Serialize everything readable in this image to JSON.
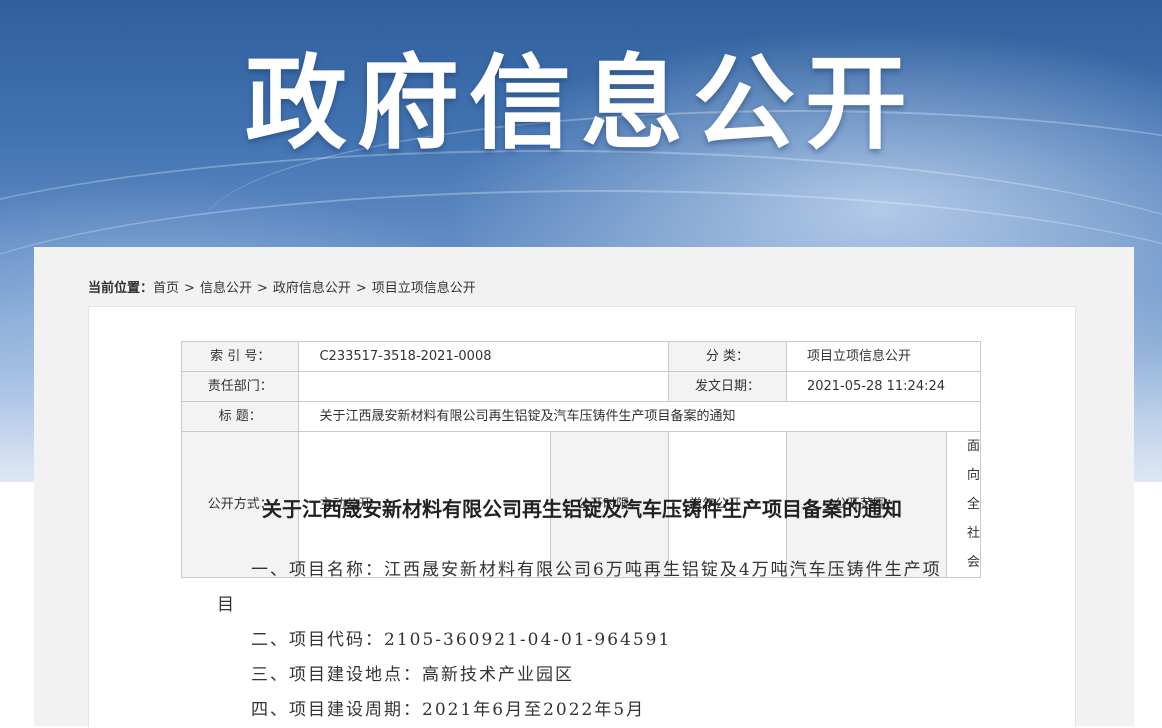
{
  "banner": {
    "title": "政府信息公开"
  },
  "breadcrumb": {
    "lead": "当前位置：",
    "items": [
      "首页",
      "信息公开",
      "政府信息公开",
      "项目立项信息公开"
    ],
    "separator": ">"
  },
  "meta": {
    "index_label": "索 引 号：",
    "index_value": "C233517-3518-2021-0008",
    "category_label": "分  类：",
    "category_value": "项目立项信息公开",
    "dept_label": "责任部门：",
    "dept_value": "",
    "date_label": "发文日期：",
    "date_value": "2021-05-28 11:24:24",
    "title_label": "标  题：",
    "title_value": "关于江西晟安新材料有限公司再生铝锭及汽车压铸件生产项目备案的通知",
    "method_label": "公开方式：",
    "method_value": "主动公开",
    "period_label": "公开时限：",
    "period_value": "常年公开",
    "scope_label": "公开范围：",
    "scope_value": "面向全社会"
  },
  "document": {
    "title": "关于江西晟安新材料有限公司再生铝锭及汽车压铸件生产项目备案的通知",
    "paragraphs": [
      "一、项目名称：江西晟安新材料有限公司6万吨再生铝锭及4万吨汽车压铸件生产项目",
      "二、项目代码：2105-360921-04-01-964591",
      "三、项目建设地点：高新技术产业园区",
      "四、项目建设周期：2021年6月至2022年5月"
    ]
  }
}
